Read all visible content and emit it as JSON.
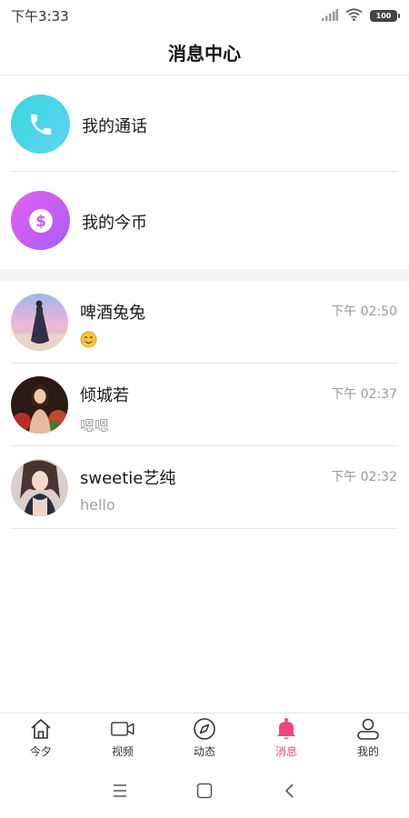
{
  "status_bar": {
    "time": "下午3:33",
    "battery": "100",
    "icons": [
      "signal-icon",
      "wifi-icon",
      "battery-icon"
    ]
  },
  "header": {
    "title": "消息中心"
  },
  "menu": [
    {
      "label": "我的通话",
      "icon": "phone-icon",
      "color": "#4fd6e9"
    },
    {
      "label": "我的今币",
      "icon": "dollar-coin-icon",
      "color": "#c65ff2"
    }
  ],
  "conversations": [
    {
      "name": "啤酒兔兔",
      "time": "下午 02:50",
      "preview": "😊",
      "preview_type": "emoji",
      "avatar": "avatar-woman-dress"
    },
    {
      "name": "倾城若",
      "time": "下午 02:37",
      "preview": "嗯嗯",
      "preview_type": "text",
      "avatar": "avatar-woman-flowers"
    },
    {
      "name": "sweetie艺纯",
      "time": "下午 02:32",
      "preview": "hello",
      "preview_type": "text",
      "avatar": "avatar-woman-portrait"
    }
  ],
  "tabbar": {
    "active_color": "#f0467a",
    "items": [
      {
        "label": "今夕",
        "icon": "home-icon",
        "active": false
      },
      {
        "label": "视频",
        "icon": "video-camera-icon",
        "active": false
      },
      {
        "label": "动态",
        "icon": "compass-icon",
        "active": false
      },
      {
        "label": "消息",
        "icon": "bell-icon",
        "active": true
      },
      {
        "label": "我的",
        "icon": "person-icon",
        "active": false
      }
    ]
  },
  "system_nav": {
    "icons": [
      "menu-icon",
      "home-square-icon",
      "back-icon"
    ]
  }
}
